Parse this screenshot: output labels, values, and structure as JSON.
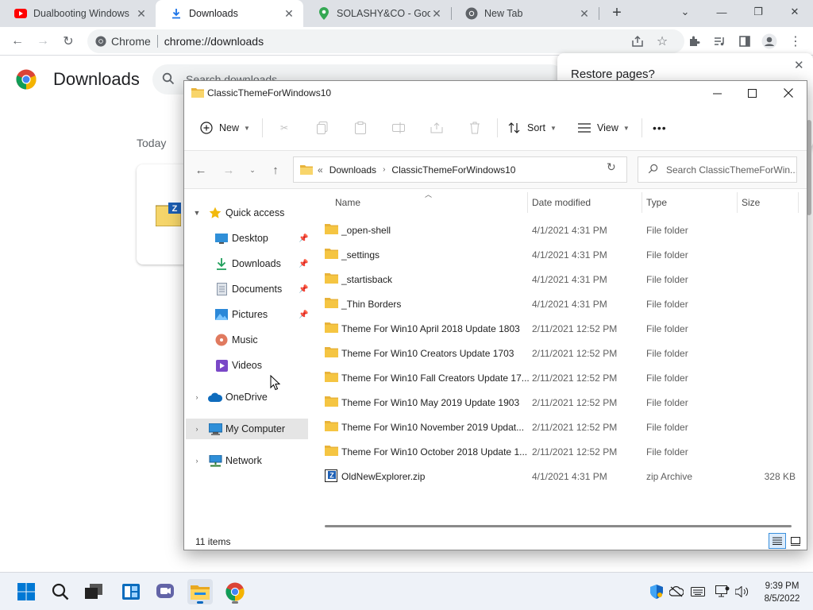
{
  "browser": {
    "tabs": [
      {
        "title": "Dualbooting Windows",
        "icon": "youtube-icon"
      },
      {
        "title": "Downloads",
        "icon": "download-icon"
      },
      {
        "title": "SOLASHY&CO - Goog",
        "icon": "maps-pin-icon"
      },
      {
        "title": "New Tab",
        "icon": "chrome-icon"
      }
    ],
    "omnibox": {
      "site_label": "Chrome",
      "url": "chrome://downloads"
    }
  },
  "downloads_page": {
    "title": "Downloads",
    "search_placeholder": "Search downloads",
    "section": "Today",
    "restore_prompt": "Restore pages?"
  },
  "explorer": {
    "window_title": "ClassicThemeForWindows10",
    "commands": {
      "new": "New",
      "sort": "Sort",
      "view": "View",
      "more": "•••"
    },
    "breadcrumb": {
      "prefix": "«",
      "parts": [
        "Downloads",
        "ClassicThemeForWindows10"
      ]
    },
    "search_placeholder": "Search ClassicThemeForWin...",
    "nav": {
      "quick_access": "Quick access",
      "pinned": [
        {
          "label": "Desktop",
          "icon": "desktop-icon",
          "pinned": true
        },
        {
          "label": "Downloads",
          "icon": "download-arrow-icon",
          "pinned": true
        },
        {
          "label": "Documents",
          "icon": "documents-icon",
          "pinned": true
        },
        {
          "label": "Pictures",
          "icon": "pictures-icon",
          "pinned": true
        },
        {
          "label": "Music",
          "icon": "music-icon",
          "pinned": false
        },
        {
          "label": "Videos",
          "icon": "videos-icon",
          "pinned": false
        }
      ],
      "onedrive": "OneDrive",
      "my_computer": "My Computer",
      "network": "Network"
    },
    "columns": {
      "name": "Name",
      "date": "Date modified",
      "type": "Type",
      "size": "Size"
    },
    "files": [
      {
        "name": "_open-shell",
        "date": "4/1/2021 4:31 PM",
        "type": "File folder",
        "size": "",
        "kind": "folder"
      },
      {
        "name": "_settings",
        "date": "4/1/2021 4:31 PM",
        "type": "File folder",
        "size": "",
        "kind": "folder"
      },
      {
        "name": "_startisback",
        "date": "4/1/2021 4:31 PM",
        "type": "File folder",
        "size": "",
        "kind": "folder"
      },
      {
        "name": "_Thin Borders",
        "date": "4/1/2021 4:31 PM",
        "type": "File folder",
        "size": "",
        "kind": "folder"
      },
      {
        "name": "Theme For Win10 April 2018 Update 1803",
        "date": "2/11/2021 12:52 PM",
        "type": "File folder",
        "size": "",
        "kind": "folder"
      },
      {
        "name": "Theme For Win10 Creators Update 1703",
        "date": "2/11/2021 12:52 PM",
        "type": "File folder",
        "size": "",
        "kind": "folder"
      },
      {
        "name": "Theme For Win10 Fall Creators Update 17...",
        "date": "2/11/2021 12:52 PM",
        "type": "File folder",
        "size": "",
        "kind": "folder"
      },
      {
        "name": "Theme For Win10 May 2019 Update 1903",
        "date": "2/11/2021 12:52 PM",
        "type": "File folder",
        "size": "",
        "kind": "folder"
      },
      {
        "name": "Theme For Win10 November 2019 Updat...",
        "date": "2/11/2021 12:52 PM",
        "type": "File folder",
        "size": "",
        "kind": "folder"
      },
      {
        "name": "Theme For Win10 October 2018 Update 1...",
        "date": "2/11/2021 12:52 PM",
        "type": "File folder",
        "size": "",
        "kind": "folder"
      },
      {
        "name": "OldNewExplorer.zip",
        "date": "4/1/2021 4:31 PM",
        "type": "zip Archive",
        "size": "328 KB",
        "kind": "zip"
      }
    ],
    "status": "11 items"
  },
  "taskbar": {
    "apps": [
      "start-icon",
      "search-icon",
      "task-view-icon",
      "widgets-icon",
      "teams-chat-icon",
      "file-explorer-icon",
      "chrome-icon"
    ],
    "clock": {
      "time": "9:39 PM",
      "date": "8/5/2022"
    }
  },
  "colors": {
    "folder": "#f5c542",
    "accent": "#0067c0",
    "chrome_red": "#db4437",
    "chrome_green": "#0f9d58",
    "chrome_yellow": "#f4b400",
    "chrome_blue": "#4285f4"
  }
}
